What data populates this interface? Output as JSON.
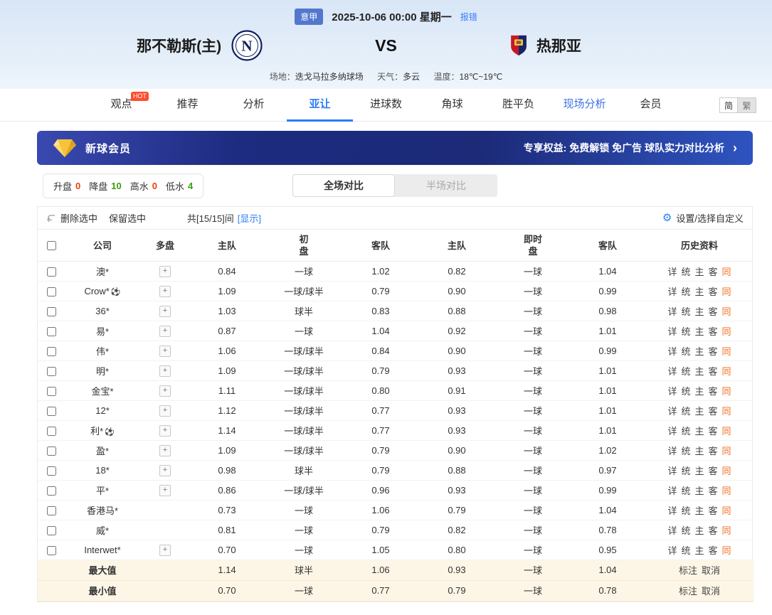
{
  "match_header": {
    "league": "意甲",
    "datetime": "2025-10-06 00:00 星期一",
    "report_error": "报错",
    "home_team": "那不勒斯(主)",
    "home_logo_letter": "N",
    "vs": "VS",
    "away_team": "热那亚",
    "venue_label": "场地：",
    "venue": "迭戈马拉多纳球场",
    "weather_label": "天气：",
    "weather": "多云",
    "temperature_label": "温度：",
    "temperature": "18℃~19℃"
  },
  "nav": {
    "items": [
      {
        "label": "观点",
        "hot": "HOT"
      },
      {
        "label": "推荐"
      },
      {
        "label": "分析"
      },
      {
        "label": "亚让",
        "active": true
      },
      {
        "label": "进球数"
      },
      {
        "label": "角球"
      },
      {
        "label": "胜平负"
      },
      {
        "label": "现场分析",
        "highlight": true
      },
      {
        "label": "会员"
      }
    ],
    "lang": {
      "simplified": "简",
      "traditional": "繁"
    }
  },
  "promo_banner": {
    "title": "新球会员",
    "benefits": "专享权益: 免费解锁 免广告 球队实力对比分析",
    "arrow": "›"
  },
  "filter_bar": {
    "stats": [
      {
        "label": "升盘",
        "value": "0",
        "color": "#e8420e"
      },
      {
        "label": "降盘",
        "value": "10",
        "color": "#3a9c0e"
      },
      {
        "label": "高水",
        "value": "0",
        "color": "#e8420e"
      },
      {
        "label": "低水",
        "value": "4",
        "color": "#3a9c0e"
      }
    ],
    "tabs": {
      "full": "全场对比",
      "half": "半场对比"
    }
  },
  "toolbar": {
    "delete_selected": "删除选中",
    "keep_selected": "保留选中",
    "count": "共[15/15]间",
    "show": "[显示]",
    "settings": "设置/选择自定义"
  },
  "odds_table": {
    "header": {
      "company": "公司",
      "multi": "多盘",
      "home": "主队",
      "away": "客队",
      "line": "盘",
      "init": "初",
      "live": "即时",
      "history": "历史资料"
    },
    "plus": "+",
    "history_links": [
      "详",
      "统",
      "主",
      "客"
    ],
    "history_link_same": "同",
    "rows": [
      {
        "company": "澳*",
        "ball": false,
        "multi": true,
        "init": [
          "0.84",
          "一球",
          "1.02"
        ],
        "live": [
          "0.82",
          "一球",
          "1.04"
        ]
      },
      {
        "company": "Crow*",
        "ball": true,
        "multi": true,
        "init": [
          "1.09",
          "一球/球半",
          "0.79"
        ],
        "live": [
          "0.90",
          "一球",
          "0.99"
        ]
      },
      {
        "company": "36*",
        "ball": false,
        "multi": true,
        "init": [
          "1.03",
          "球半",
          "0.83"
        ],
        "live": [
          "0.88",
          "一球",
          "0.98"
        ]
      },
      {
        "company": "易*",
        "ball": false,
        "multi": true,
        "init": [
          "0.87",
          "一球",
          "1.04"
        ],
        "live": [
          "0.92",
          "一球",
          "1.01"
        ]
      },
      {
        "company": "伟*",
        "ball": false,
        "multi": true,
        "init": [
          "1.06",
          "一球/球半",
          "0.84"
        ],
        "live": [
          "0.90",
          "一球",
          "0.99"
        ]
      },
      {
        "company": "明*",
        "ball": false,
        "multi": true,
        "init": [
          "1.09",
          "一球/球半",
          "0.79"
        ],
        "live": [
          "0.93",
          "一球",
          "1.01"
        ]
      },
      {
        "company": "金宝*",
        "ball": false,
        "multi": true,
        "init": [
          "1.11",
          "一球/球半",
          "0.80"
        ],
        "live": [
          "0.91",
          "一球",
          "1.01"
        ]
      },
      {
        "company": "12*",
        "ball": false,
        "multi": true,
        "init": [
          "1.12",
          "一球/球半",
          "0.77"
        ],
        "live": [
          "0.93",
          "一球",
          "1.01"
        ]
      },
      {
        "company": "利*",
        "ball": true,
        "multi": true,
        "init": [
          "1.14",
          "一球/球半",
          "0.77"
        ],
        "live": [
          "0.93",
          "一球",
          "1.01"
        ]
      },
      {
        "company": "盈*",
        "ball": false,
        "multi": true,
        "init": [
          "1.09",
          "一球/球半",
          "0.79"
        ],
        "live": [
          "0.90",
          "一球",
          "1.02"
        ]
      },
      {
        "company": "18*",
        "ball": false,
        "multi": true,
        "init": [
          "0.98",
          "球半",
          "0.79"
        ],
        "live": [
          "0.88",
          "一球",
          "0.97"
        ]
      },
      {
        "company": "平*",
        "ball": false,
        "multi": true,
        "init": [
          "0.86",
          "一球/球半",
          "0.96"
        ],
        "live": [
          "0.93",
          "一球",
          "0.99"
        ]
      },
      {
        "company": "香港马*",
        "ball": false,
        "multi": false,
        "init": [
          "0.73",
          "一球",
          "1.06"
        ],
        "live": [
          "0.79",
          "一球",
          "1.04"
        ]
      },
      {
        "company": "威*",
        "ball": false,
        "multi": false,
        "init": [
          "0.81",
          "一球",
          "0.79"
        ],
        "live": [
          "0.82",
          "一球",
          "0.78"
        ]
      },
      {
        "company": "Interwet*",
        "ball": false,
        "multi": true,
        "init": [
          "0.70",
          "一球",
          "1.05"
        ],
        "live": [
          "0.80",
          "一球",
          "0.95"
        ]
      }
    ],
    "footer": [
      {
        "label": "最大值",
        "init": [
          "1.14",
          "球半",
          "1.06"
        ],
        "live": [
          "0.93",
          "一球",
          "1.04"
        ],
        "actions": [
          "标注",
          "取消"
        ]
      },
      {
        "label": "最小值",
        "init": [
          "0.70",
          "一球",
          "0.77"
        ],
        "live": [
          "0.79",
          "一球",
          "0.78"
        ],
        "actions": [
          "标注",
          "取消"
        ]
      }
    ]
  }
}
